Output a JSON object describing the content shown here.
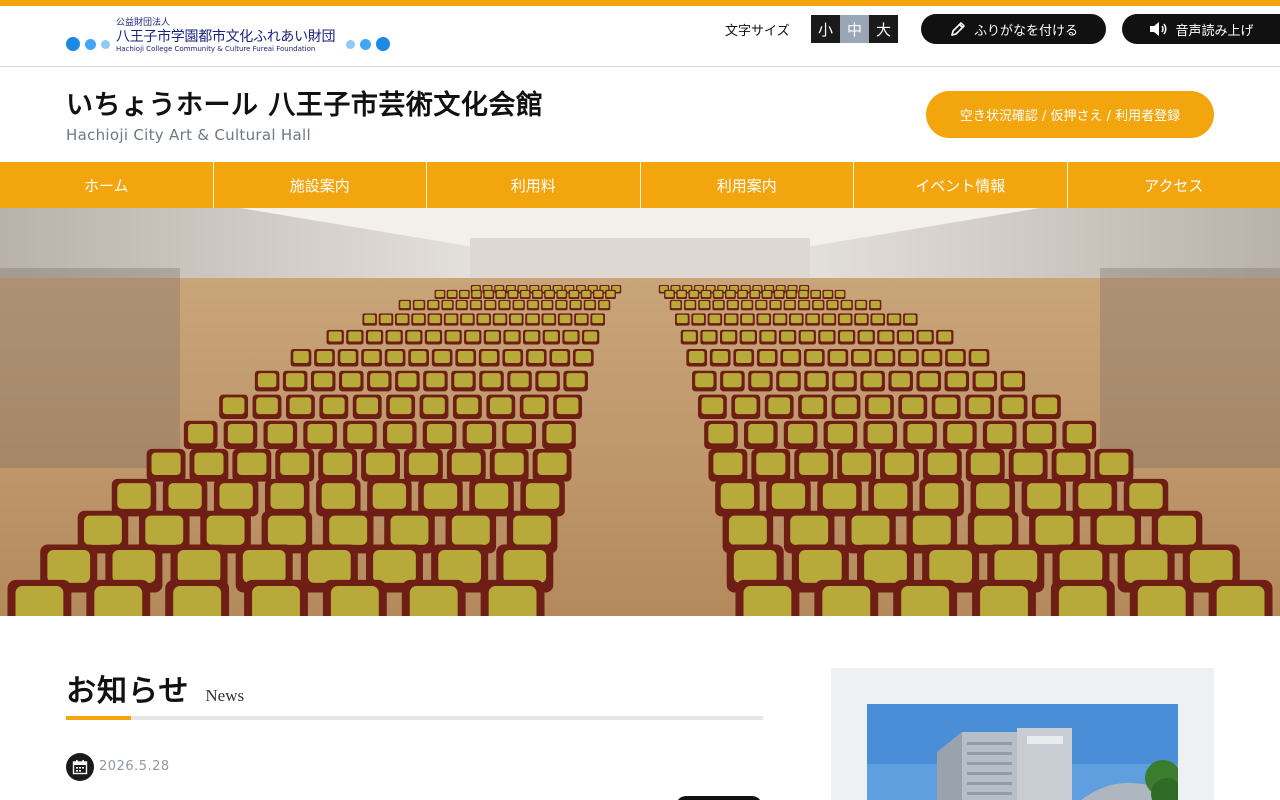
{
  "header": {
    "logo": {
      "small": "公益財団法人",
      "name": "八王子市学園都市文化ふれあい財団",
      "english": "Hachioji College Community & Culture Fureai Foundation"
    },
    "font_size_label": "文字サイズ",
    "font_sizes": [
      "小",
      "中",
      "大"
    ],
    "font_size_selected": "中",
    "furigana_label": "ふりがなを付ける",
    "speech_label": "音声読み上げ"
  },
  "site": {
    "title": "いちょうホール 八王子市芸術文化会館",
    "subtitle": "Hachioji City Art & Cultural Hall",
    "reserve_label": "空き状況確認 / 仮押さえ / 利用者登録"
  },
  "nav": {
    "items": [
      "ホーム",
      "施設案内",
      "利用料",
      "利用案内",
      "イベント情報",
      "アクセス"
    ]
  },
  "news": {
    "title": "お知らせ",
    "title_en": "News",
    "items": [
      {
        "date": "2026.5.28"
      }
    ]
  },
  "colors": {
    "accent": "#f2a50c",
    "dark": "#111111",
    "muted": "#8e99a6",
    "panel": "#eef1f4",
    "logo_blue": "#1a237e"
  },
  "icons": [
    "pencil-icon",
    "speaker-icon",
    "calendar-icon"
  ]
}
